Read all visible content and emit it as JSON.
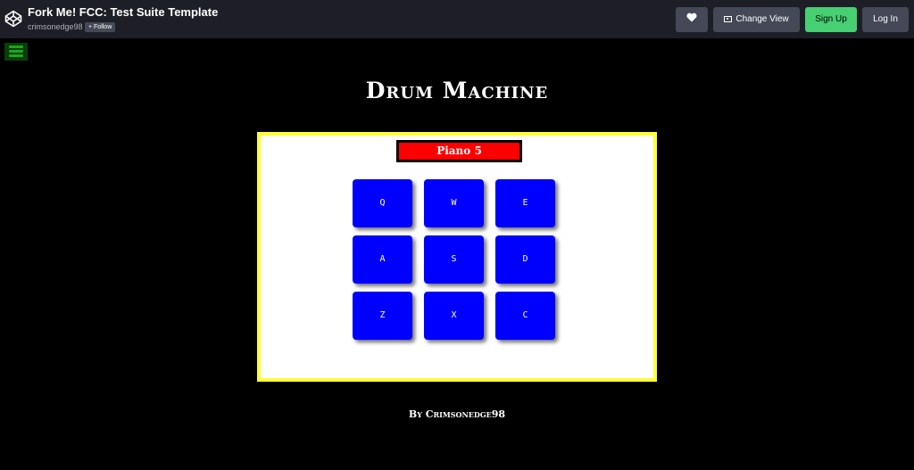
{
  "header": {
    "logo_icon": "codepen-logo-icon",
    "title": "Fork Me! FCC: Test Suite Template",
    "author": "crimsonedge98",
    "follow_label": "+ Follow",
    "heart_icon": "heart-icon",
    "change_view_icon": "layout-icon",
    "change_view_label": "Change View",
    "signup_label": "Sign Up",
    "login_label": "Log In"
  },
  "colors": {
    "signup_accent": "#47cf73",
    "display_background": "#ff0000",
    "pad_background": "#0000ff",
    "machine_border": "#ffff33",
    "menu_icon": "#1aa81a"
  },
  "menu": {
    "icon": "hamburger-menu-icon"
  },
  "app": {
    "heading": "Drum Machine",
    "display": "Piano 5",
    "pads": [
      "Q",
      "W",
      "E",
      "A",
      "S",
      "D",
      "Z",
      "X",
      "C"
    ],
    "credit": "By Crimsonedge98"
  }
}
